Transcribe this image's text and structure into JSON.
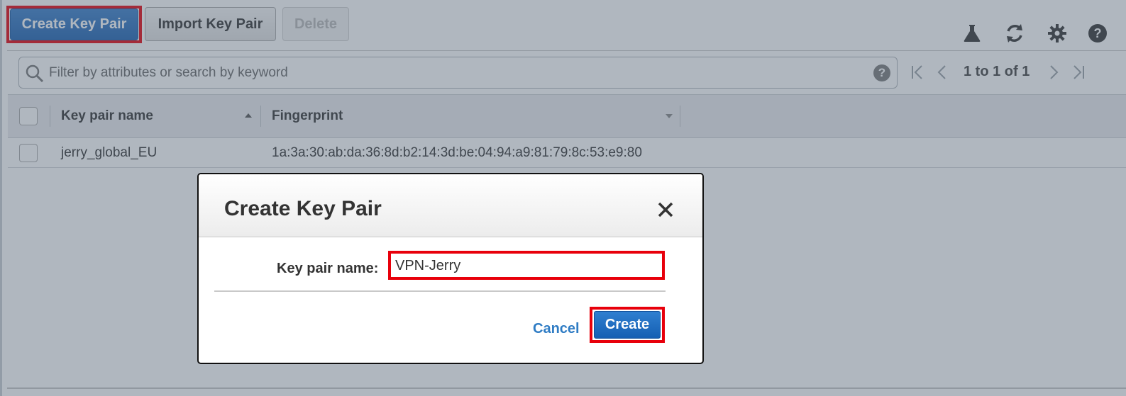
{
  "toolbar": {
    "create_label": "Create Key Pair",
    "import_label": "Import Key Pair",
    "delete_label": "Delete",
    "icons": [
      "flask-icon",
      "refresh-icon",
      "gear-icon",
      "help-icon"
    ]
  },
  "search": {
    "placeholder": "Filter by attributes or search by keyword",
    "help_glyph": "?"
  },
  "pagination": {
    "text": "1 to 1 of 1"
  },
  "table": {
    "columns": [
      "Key pair name",
      "Fingerprint"
    ],
    "rows": [
      {
        "name": "jerry_global_EU",
        "fingerprint": "1a:3a:30:ab:da:36:8d:b2:14:3d:be:04:94:a9:81:79:8c:53:e9:80"
      }
    ]
  },
  "modal": {
    "title": "Create Key Pair",
    "field_label": "Key pair name:",
    "field_value": "VPN-Jerry",
    "cancel_label": "Cancel",
    "create_label": "Create"
  },
  "colors": {
    "highlight": "#e8000b",
    "primary": "#1f63b3",
    "link": "#2f7cc4"
  }
}
